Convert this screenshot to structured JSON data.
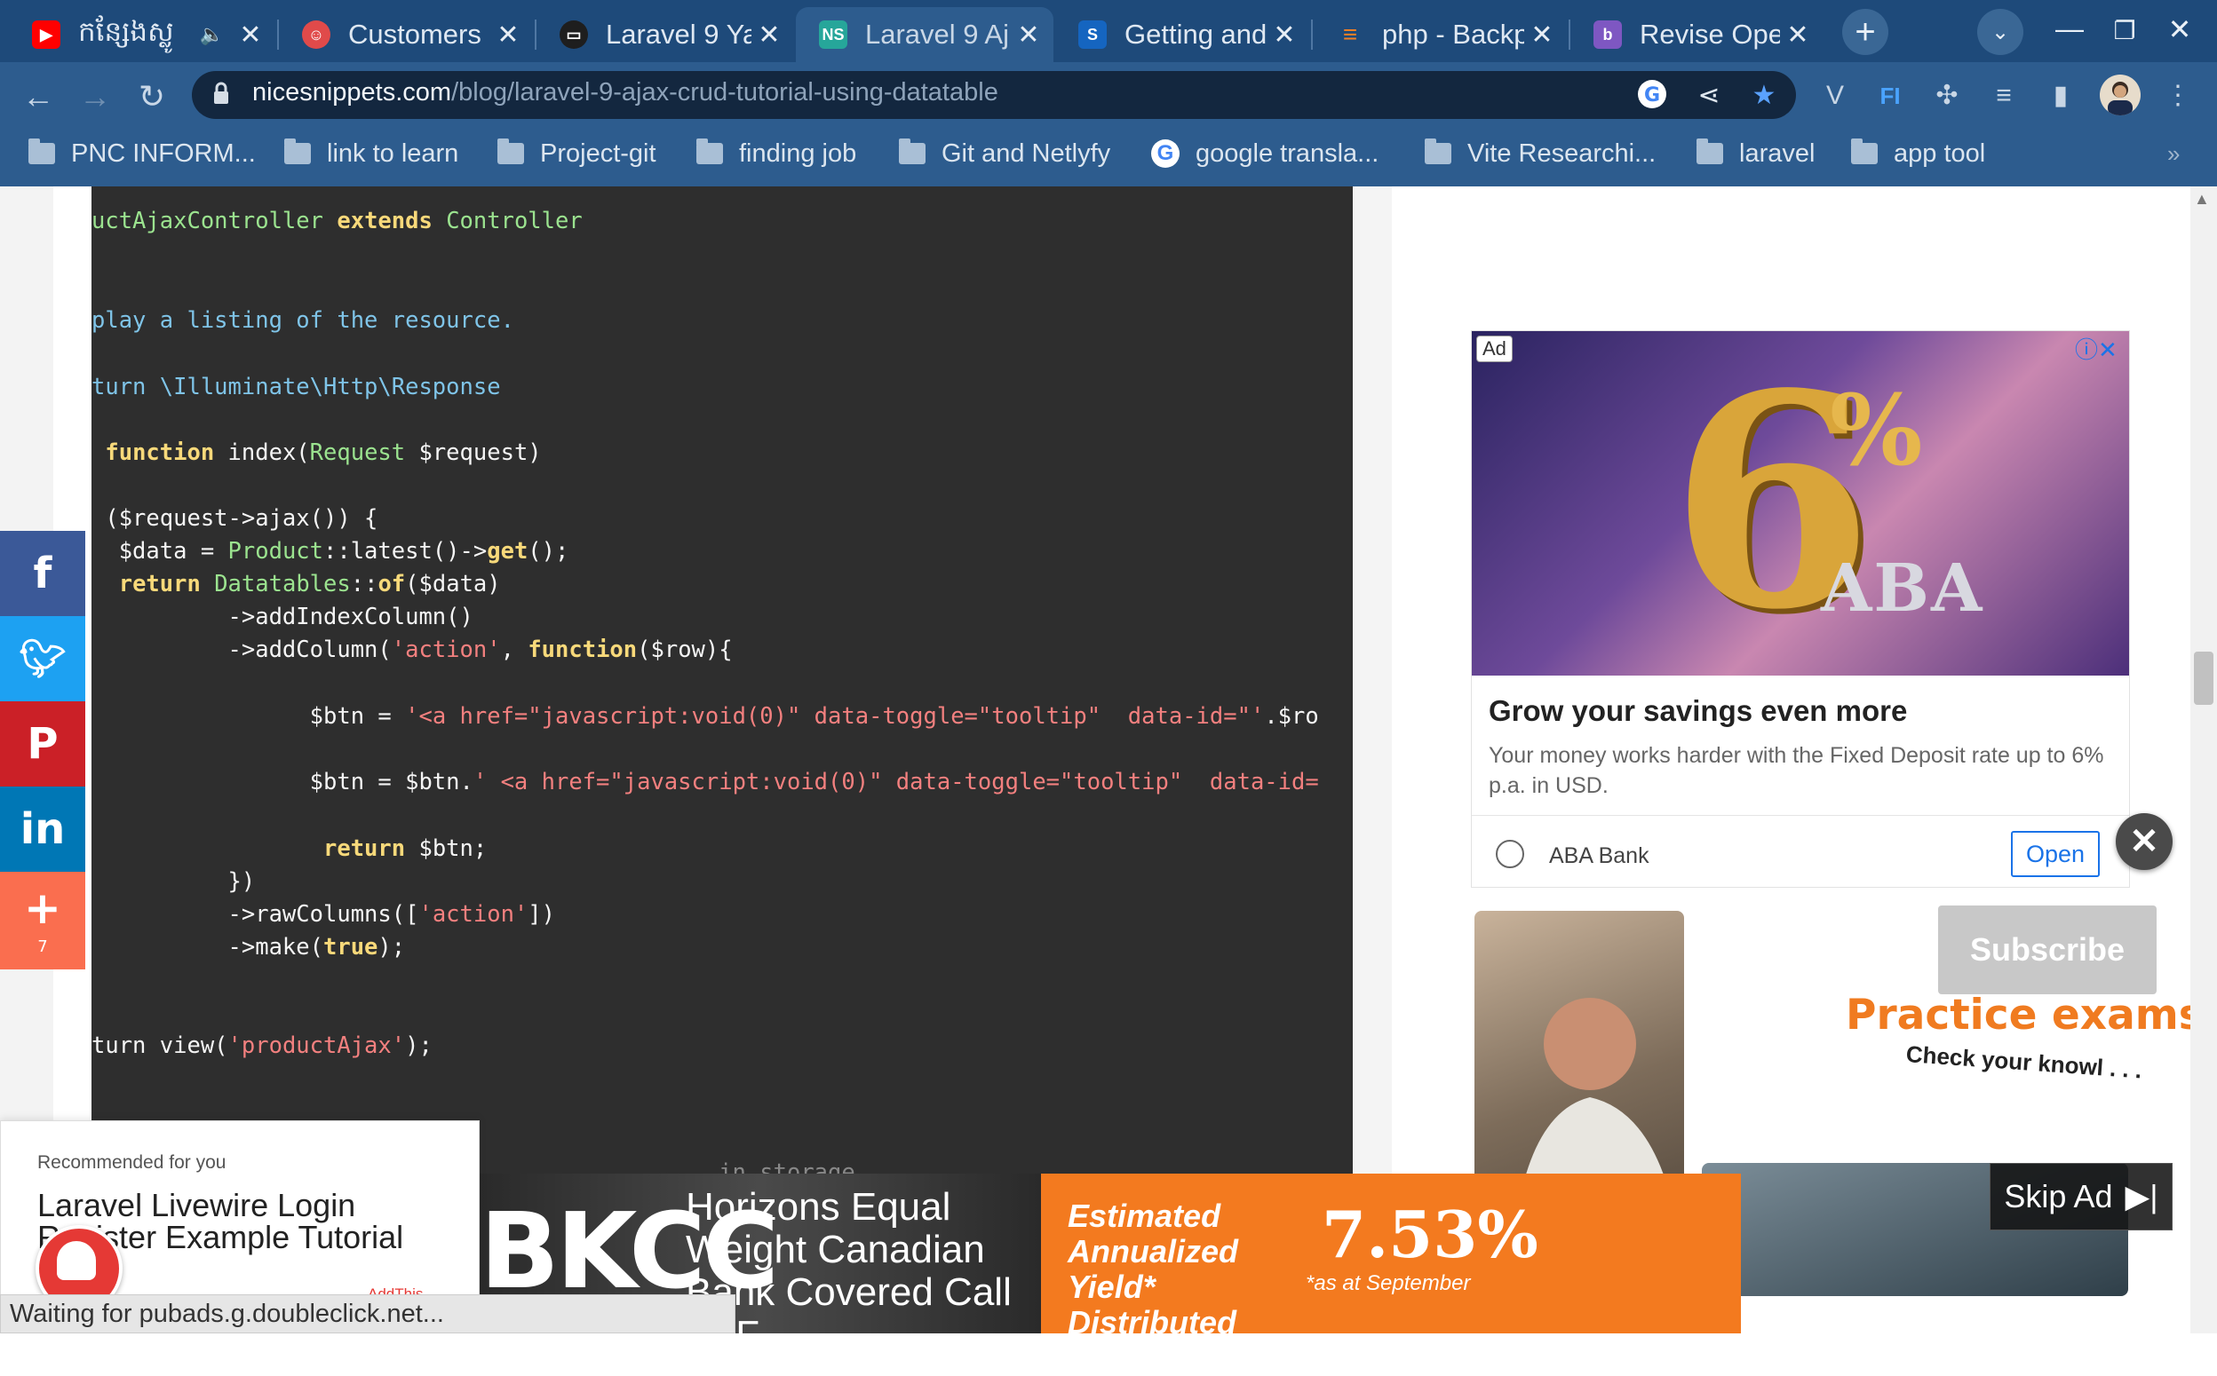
{
  "tabs": [
    {
      "title": "កន្សែងស្លូ",
      "favicon": "youtube-icon",
      "color": "#ff0000"
    },
    {
      "title": "Customers :",
      "favicon": "app-icon",
      "color": "#e04a4a"
    },
    {
      "title": "Laravel 9 Ya",
      "favicon": "laptop-icon",
      "color": "#1e1e1e"
    },
    {
      "title": "Laravel 9 Aj",
      "favicon": "ns-icon",
      "color": "#26a69a"
    },
    {
      "title": "Getting and",
      "favicon": "s-icon",
      "color": "#1565c0"
    },
    {
      "title": "php - Backp",
      "favicon": "stackoverflow-icon",
      "color": "#f48024"
    },
    {
      "title": "Revise Oper",
      "favicon": "b-icon",
      "color": "#7e57c2"
    }
  ],
  "address": {
    "host": "nicesnippets.com",
    "path": "/blog/laravel-9-ajax-crud-tutorial-using-datatable"
  },
  "bookmarks": [
    "PNC INFORM...",
    "link to learn",
    "Project-git",
    "finding job",
    "Git and Netlyfy",
    "google transla...",
    "Vite Researchi...",
    "laravel",
    "app tool"
  ],
  "bookmarks_more": "»",
  "code_lines": [
    "uctAjaxController extends Controller",
    "play a listing of the resource.",
    "turn \\Illuminate\\Http\\Response",
    " function index(Request $request)",
    " ($request->ajax()) {",
    "  $data = Product::latest()->get();",
    "  return Datatables::of($data)",
    "          ->addIndexColumn()",
    "          ->addColumn('action', function($row){",
    "                $btn = '<a href=\"javascript:void(0)\" data-toggle=\"tooltip\"  data-id=\"'.$ro",
    "                $btn = $btn.' <a href=\"javascript:void(0)\" data-toggle=\"tooltip\"  data-id=",
    "                 return $btn;",
    "          })",
    "          ->rawColumns(['action'])",
    "          ->make(true);",
    "turn view('productAjax');",
    "                                              in storage."
  ],
  "share": {
    "count": "7"
  },
  "ad": {
    "tag": "Ad",
    "image_big": "6",
    "image_pct": "%",
    "image_brand": "ABA",
    "title": "Grow your savings even more",
    "body": "Your money works harder with the Fixed Deposit rate up to 6% p.a. in USD.",
    "brand": "ABA Bank",
    "open_label": "Open"
  },
  "video_ad": {
    "subscribe": "Subscribe",
    "headline": "Practice exams",
    "sub": "Check your knowl . . .",
    "skip": "Skip Ad"
  },
  "recommended": {
    "label": "Recommended for you",
    "title": "Laravel Livewire Login Register Example Tutorial",
    "addthis": "AddThis"
  },
  "banner": {
    "ticker": "BKCC",
    "name": "Horizons Equal Weight Canadian Bank Covered Call ETF",
    "yield_label": "Estimated Annualized Yield* Distributed Monthly",
    "rate": "7.53%",
    "asat": "*as at September"
  },
  "status": "Waiting for pubads.g.doubleclick.net...",
  "colors": {
    "chrome_dark": "#1e4a7a",
    "chrome": "#2d5c8e",
    "code_bg": "#2e2e2e",
    "accent_orange": "#f37a1f"
  }
}
